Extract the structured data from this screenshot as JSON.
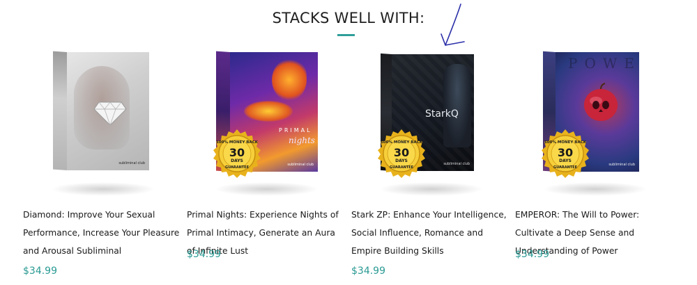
{
  "section": {
    "heading": "STACKS WELL WITH:",
    "accent_color": "#2f9e9a"
  },
  "badge": {
    "top_text": "100% MONEY BACK",
    "number": "30",
    "unit": "DAYS",
    "bottom_text": "GUARANTEE"
  },
  "products": [
    {
      "title": "Diamond: Improve Your Sexual Performance, Increase Your Pleasure and Arousal Subliminal",
      "price": "$34.99",
      "box_label": "",
      "brand_tag": "subliminal club",
      "has_badge": false
    },
    {
      "title": "Primal Nights: Experience Nights of Primal Intimacy, Generate an Aura of Infinite Lust",
      "price": "$34.99",
      "box_label": "PRIMAL",
      "box_script": "nights",
      "brand_tag": "subliminal club",
      "has_badge": true
    },
    {
      "title": "Stark ZP: Enhance Your Intelligence, Social Influence, Romance and Empire Building Skills",
      "price": "$34.99",
      "box_label": "StarkQ",
      "brand_tag": "subliminal club",
      "has_badge": true
    },
    {
      "title": "EMPEROR: The Will to Power: Cultivate a Deep Sense and Understanding of Power",
      "price": "$34.99",
      "box_label": "POWER",
      "brand_tag": "subliminal club",
      "has_badge": true
    }
  ]
}
